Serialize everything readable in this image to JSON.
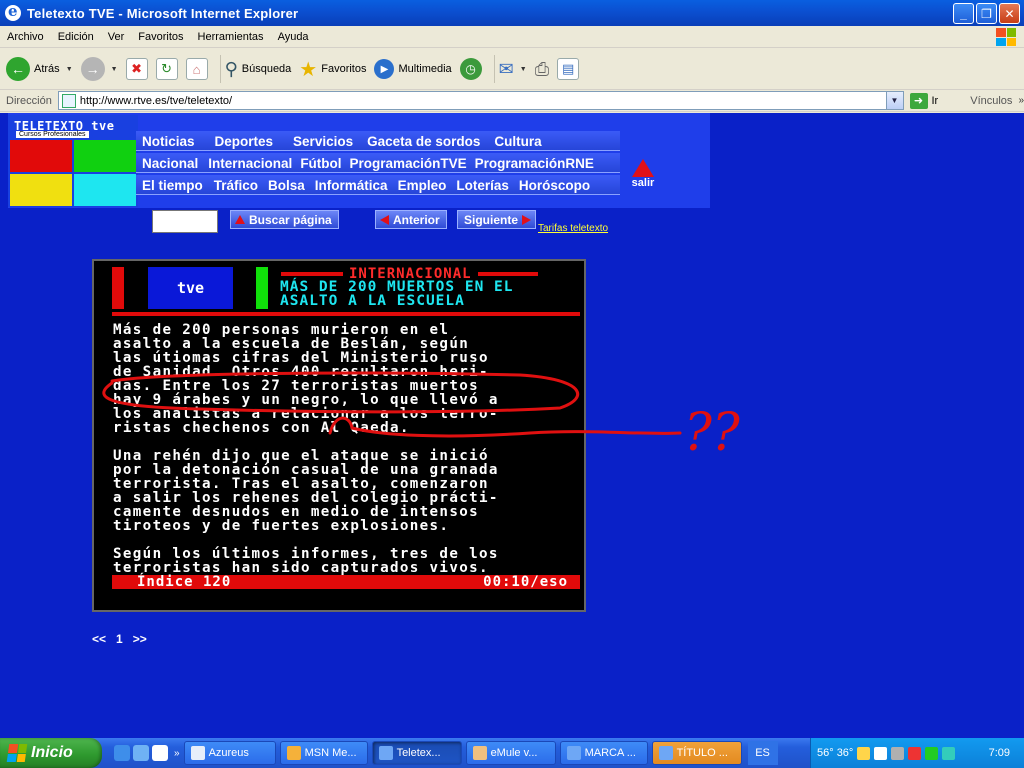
{
  "window": {
    "title": "Teletexto TVE - Microsoft Internet Explorer",
    "buttons": [
      "_",
      "❐",
      "✕"
    ]
  },
  "menu": [
    "Archivo",
    "Edición",
    "Ver",
    "Favoritos",
    "Herramientas",
    "Ayuda"
  ],
  "toolbar": {
    "back": "Atrás",
    "search": "Búsqueda",
    "favorites": "Favoritos",
    "multimedia": "Multimedia"
  },
  "address": {
    "label": "Dirección",
    "url": "http://www.rtve.es/tve/teletexto/",
    "go": "Ir",
    "links": "Vínculos"
  },
  "banner": {
    "logo": "TELETEXTO tve",
    "subtitle": "Cursos Profesionales",
    "row1": [
      "Noticias",
      "Deportes",
      "Servicios",
      "Gaceta de sordos",
      "Cultura"
    ],
    "row2": [
      "Nacional",
      "Internacional",
      "Fútbol",
      "ProgramaciónTVE",
      "ProgramaciónRNE"
    ],
    "row3": [
      "El tiempo",
      "Tráfico",
      "Bolsa",
      "Informática",
      "Empleo",
      "Loterías",
      "Horóscopo"
    ],
    "exit": "salir"
  },
  "controls": {
    "search_button": "Buscar página",
    "prev": "Anterior",
    "next": "Siguiente",
    "tarifas": "Tarifas teletexto"
  },
  "teletext": {
    "logo": "tve",
    "section": "INTERNACIONAL",
    "headline": "MÁS DE 200 MUERTOS EN EL\nASALTO A LA ESCUELA",
    "body": "Más de 200 personas murieron en el\nasalto a la escuela de Beslán, según\nlas útiomas cifras del Ministerio ruso\nde Sanidad. Otros 400 resultaron heri-\ndas. Entre los 27 terroristas muertos\nhay 9 árabes y un negro, lo que llevó a\nlos analistas a relacionar a los terro-\nristas chechenos con Al Qaeda.\n\nUna rehén dijo que el ataque se inició\npor la detonación casual de una granada\nterrorista. Tras el asalto, comenzaron\na salir los rehenes del colegio prácti-\ncamente desnudos en medio de intensos\ntiroteos y de fuertes explosiones.\n\nSegún los últimos informes, tres de los\nterroristas han sido capturados vivos.",
    "footer_left": "Índice 120",
    "footer_right": "00:10/eso"
  },
  "pager": {
    "prev": "<<",
    "page": "1",
    "next": ">>"
  },
  "annotation": "??",
  "taskbar": {
    "start": "Inicio",
    "tasks": [
      "Azureus",
      "MSN Me...",
      "Teletex...",
      "eMule v...",
      "MARCA ...",
      "TÍTULO ..."
    ],
    "lang": "ES",
    "tray_text": "56° 36°",
    "clock": "7:09"
  },
  "colors": {
    "page_bg": "#0A21C8",
    "teletext_red": "#E10A0A",
    "teletext_cyan": "#1EE6F0",
    "annotation_red": "#E01010"
  }
}
